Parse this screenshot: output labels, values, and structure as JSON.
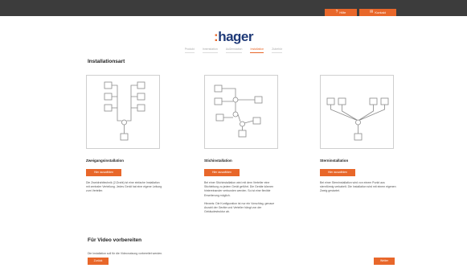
{
  "header": {
    "help_label": "Hilfe",
    "contact_label": "Kontakt",
    "help_icon": "question-icon",
    "contact_icon": "envelope-icon"
  },
  "logo": {
    "prefix": ":",
    "text": "hager"
  },
  "steps": [
    {
      "label": "Produkt",
      "active": false
    },
    {
      "label": "Innenstation",
      "active": false
    },
    {
      "label": "Außenstation",
      "active": false
    },
    {
      "label": "Installation",
      "active": true
    },
    {
      "label": "Zubehör",
      "active": false
    }
  ],
  "installation": {
    "title": "Installationsart",
    "cards": [
      {
        "title": "Zweigangsinstallation",
        "button": "Hier auswählen",
        "text": "Die Zweidrahttechnik (2-Draht) ist eine einfache Installation mit zentraler Verteilung. Jedes Gerät hat eine eigene Leitung zum Verteiler.",
        "note": ""
      },
      {
        "title": "Stichinstallation",
        "button": "Hier auswählen",
        "text": "Bei einer Stichinstallation wird mit dem Verteiler eine Stichleitung zu jedem Gerät geführt. Die Geräte können hintereinander verbunden werden. So ist eine flexible Erweiterung möglich.",
        "note": "Hinweis: Die Konfiguration ist nur ein Vorschlag, genaue Anzahl der Geräte und Verteiler hängt von der Gebäudestruktur ab."
      },
      {
        "title": "Sterninstallation",
        "button": "Hier auswählen",
        "text": "Bei einer Sterninstallation wird von einem Punkt aus sternförmig verkabelt. Die Installation wird mit einem eigenen Zweig gestartet.",
        "note": ""
      }
    ]
  },
  "video": {
    "title": "Für Video vorbereiten",
    "text": "Die Installation soll für die Videonutzung vorbereitet werden."
  },
  "footer": {
    "back_label": "Zurück",
    "next_label": "Weiter"
  },
  "colors": {
    "accent": "#e8672a",
    "brand": "#1f3a78",
    "topbar": "#3c3c3c"
  }
}
